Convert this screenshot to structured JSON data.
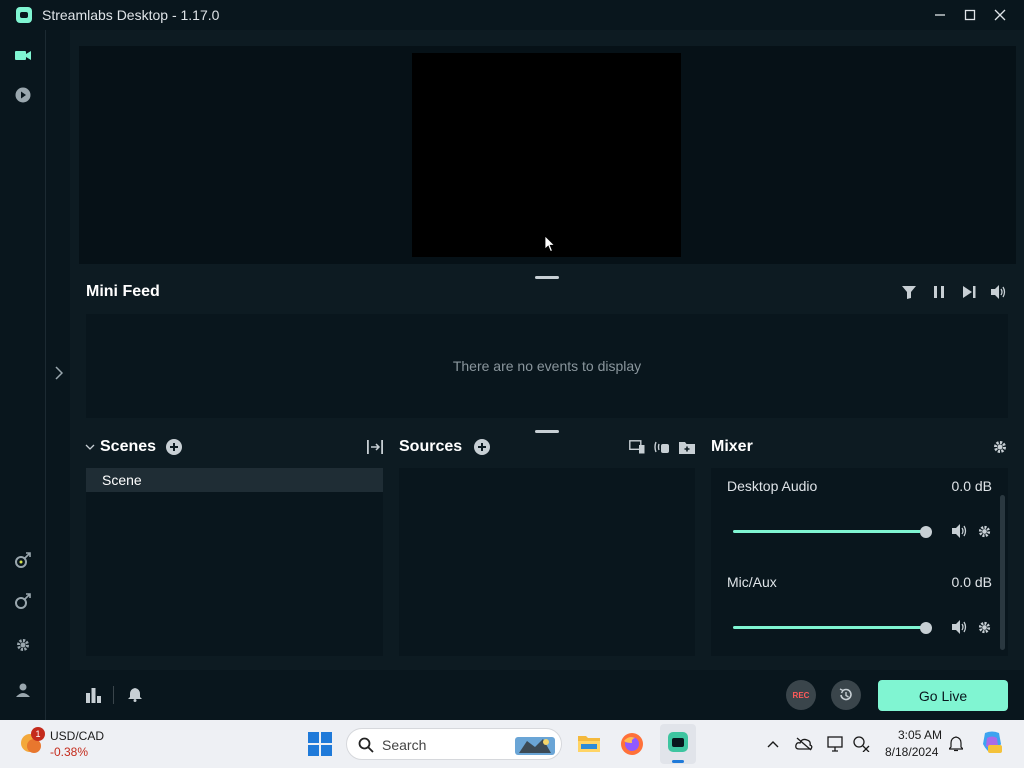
{
  "window": {
    "title": "Streamlabs Desktop - 1.17.0"
  },
  "minifeed": {
    "title": "Mini Feed",
    "empty_message": "There are no events to display"
  },
  "scenes": {
    "title": "Scenes",
    "items": [
      "Scene"
    ]
  },
  "sources": {
    "title": "Sources"
  },
  "mixer": {
    "title": "Mixer",
    "channels": [
      {
        "name": "Desktop Audio",
        "level": "0.0 dB",
        "volume_fraction": 1.0
      },
      {
        "name": "Mic/Aux",
        "level": "0.0 dB",
        "volume_fraction": 1.0
      }
    ]
  },
  "controls": {
    "rec_label": "REC",
    "go_live_label": "Go Live"
  },
  "taskbar": {
    "ticker": {
      "badge": "1",
      "name": "USD/CAD",
      "change": "-0.38%"
    },
    "search_label": "Search",
    "clock_time": "3:05 AM",
    "clock_date": "8/18/2024"
  },
  "colors": {
    "accent": "#80f5d2",
    "background": "#09161d",
    "panel": "#0d1b22"
  }
}
